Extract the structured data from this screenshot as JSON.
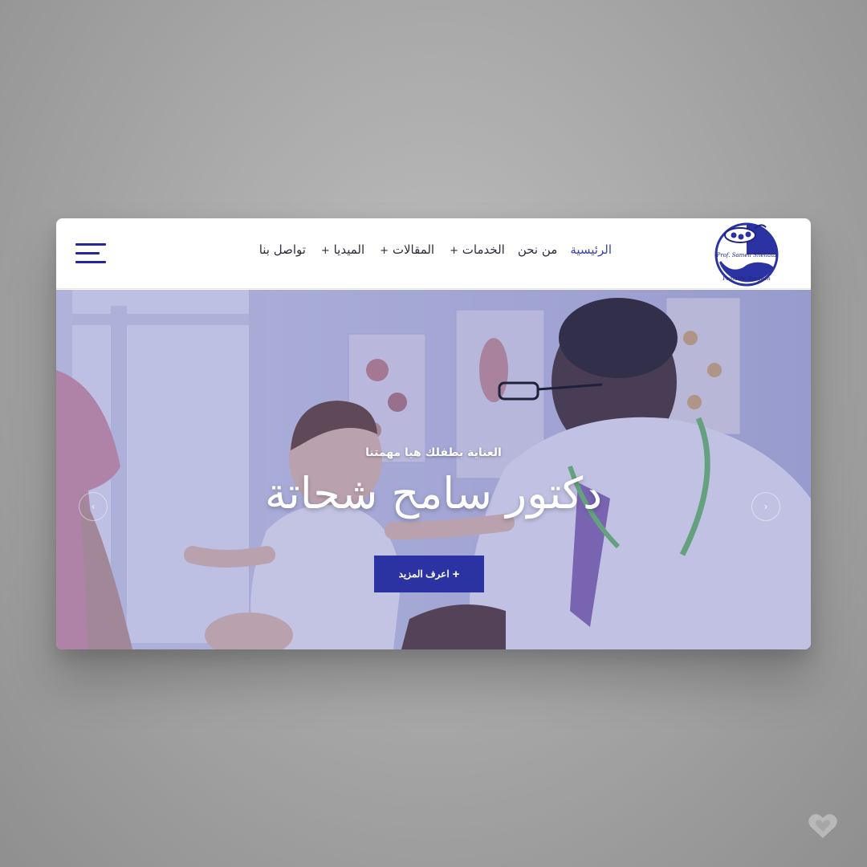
{
  "logo": {
    "name_line": "Prof. Sameh Shehata",
    "role_line": "Pediatric Surgeon"
  },
  "nav": {
    "items": [
      {
        "label": "الرئيسية",
        "has_submenu": false,
        "active": true
      },
      {
        "label": "من نحن",
        "has_submenu": false,
        "active": false
      },
      {
        "label": "الخدمات",
        "has_submenu": true,
        "active": false
      },
      {
        "label": "المقالات",
        "has_submenu": true,
        "active": false
      },
      {
        "label": "الميديا",
        "has_submenu": true,
        "active": false
      },
      {
        "label": "تواصل بنا",
        "has_submenu": false,
        "active": false
      }
    ],
    "submenu_marker": "+"
  },
  "hero": {
    "tagline": "العناية بطفلك هيا مهمتنا",
    "headline": "دكتور سامح شحاتة",
    "cta_label": "اعرف المزيد",
    "cta_icon": "+",
    "prev_arrow": "‹",
    "next_arrow": "›"
  },
  "colors": {
    "brand": "#2b33a3",
    "nav_active": "#3a43a8",
    "hamburger": "#26289a"
  },
  "icons": {
    "menu": "hamburger-icon",
    "watermark": "heart-icon"
  }
}
